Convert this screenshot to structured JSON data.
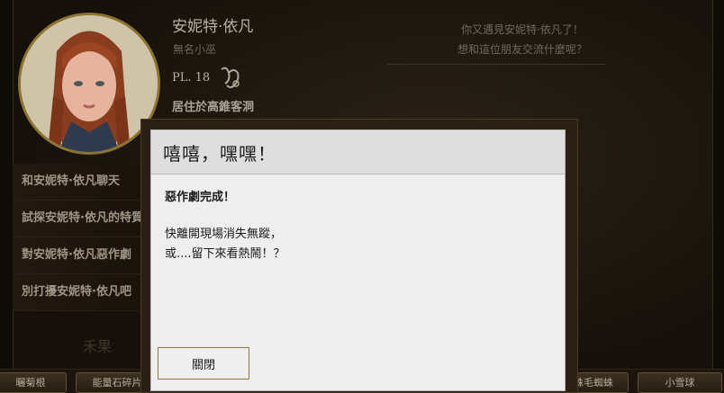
{
  "npc": {
    "name": "安妮特·依凡",
    "title": "無名小巫",
    "level": "PL. 18",
    "residence": "居住於高錐客洞",
    "greeting_line1": "你又遇見安妮特·依凡了！",
    "greeting_line2": "想和這位朋友交流什麼呢？"
  },
  "actions": [
    {
      "label": "和安妮特·依凡聊天"
    },
    {
      "label": "試探安妮特·依凡的特質"
    },
    {
      "label": "對安妮特·依凡惡作劇"
    },
    {
      "label": "別打擾安妮特·依凡吧"
    }
  ],
  "faded_label": "禾果",
  "bottom_items": [
    {
      "label": "曬菊根"
    },
    {
      "label": "能量石碎片"
    },
    {
      "label": "蛛毛蜘蛛"
    },
    {
      "label": "小雪球"
    }
  ],
  "dialog": {
    "title": "嘻嘻，嘿嘿！",
    "heading": "惡作劇完成！",
    "line1": "快離開現場消失無蹤，",
    "line2": "或....留下來看熱鬧！？",
    "close_label": "關閉"
  },
  "icons": {
    "zodiac": "zodiac-sign-icon"
  },
  "colors": {
    "portrait_border": "#8c7430",
    "button_border": "#8b7a4a"
  }
}
